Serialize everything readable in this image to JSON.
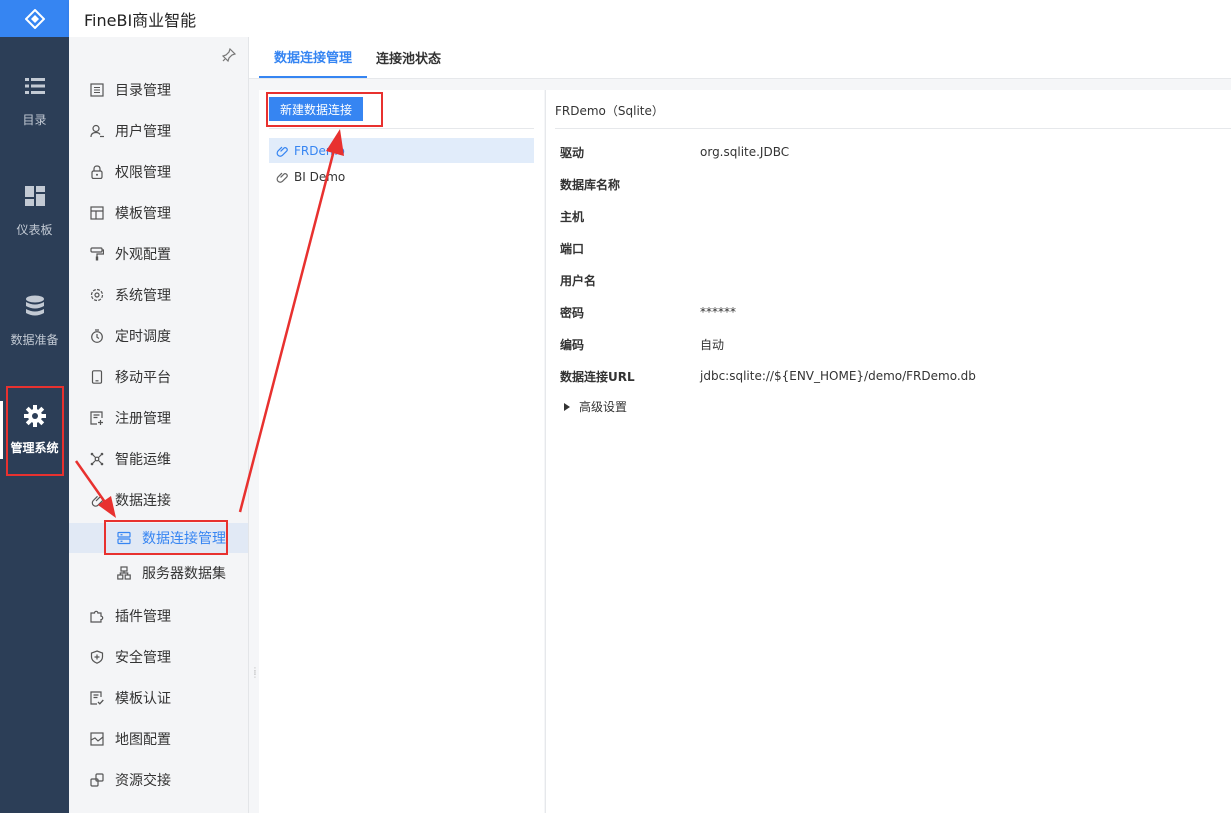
{
  "app": {
    "title": "FineBI商业智能"
  },
  "rail": {
    "items": [
      {
        "label": "目录",
        "icon": "list-icon"
      },
      {
        "label": "仪表板",
        "icon": "dashboard-icon"
      },
      {
        "label": "数据准备",
        "icon": "database-icon"
      },
      {
        "label": "管理系统",
        "icon": "gear-icon",
        "active": true
      }
    ]
  },
  "menu": {
    "items": [
      {
        "label": "目录管理",
        "icon": "catalog-icon"
      },
      {
        "label": "用户管理",
        "icon": "user-icon"
      },
      {
        "label": "权限管理",
        "icon": "lock-icon"
      },
      {
        "label": "模板管理",
        "icon": "template-icon"
      },
      {
        "label": "外观配置",
        "icon": "paint-roller-icon"
      },
      {
        "label": "系统管理",
        "icon": "settings-icon"
      },
      {
        "label": "定时调度",
        "icon": "timer-icon"
      },
      {
        "label": "移动平台",
        "icon": "mobile-icon"
      },
      {
        "label": "注册管理",
        "icon": "register-icon"
      },
      {
        "label": "智能运维",
        "icon": "network-icon"
      },
      {
        "label": "数据连接",
        "icon": "link-icon"
      },
      {
        "label": "数据连接管理",
        "icon": "server-icon",
        "sub": true,
        "selected": true
      },
      {
        "label": "服务器数据集",
        "icon": "dataset-icon",
        "sub": true
      },
      {
        "label": "插件管理",
        "icon": "plugin-icon"
      },
      {
        "label": "安全管理",
        "icon": "shield-icon"
      },
      {
        "label": "模板认证",
        "icon": "certificate-icon"
      },
      {
        "label": "地图配置",
        "icon": "map-icon"
      },
      {
        "label": "资源交接",
        "icon": "handover-icon"
      }
    ]
  },
  "tabs": [
    {
      "label": "数据连接管理",
      "active": true
    },
    {
      "label": "连接池状态"
    }
  ],
  "list": {
    "new_button": "新建数据连接",
    "connections": [
      {
        "name": "FRDemo",
        "selected": true
      },
      {
        "name": "BI Demo"
      }
    ]
  },
  "detail": {
    "title": "FRDemo（Sqlite）",
    "properties": [
      {
        "label": "驱动",
        "value": "org.sqlite.JDBC"
      },
      {
        "label": "数据库名称",
        "value": ""
      },
      {
        "label": "主机",
        "value": ""
      },
      {
        "label": "端口",
        "value": ""
      },
      {
        "label": "用户名",
        "value": ""
      },
      {
        "label": "密码",
        "value": "******"
      },
      {
        "label": "编码",
        "value": "自动"
      },
      {
        "label": "数据连接URL",
        "value": "jdbc:sqlite://${ENV_HOME}/demo/FRDemo.db"
      }
    ],
    "advanced": "高级设置"
  },
  "colors": {
    "accent": "#3685f2",
    "rail_bg": "#2c3e57",
    "annotation": "#e8312f"
  }
}
